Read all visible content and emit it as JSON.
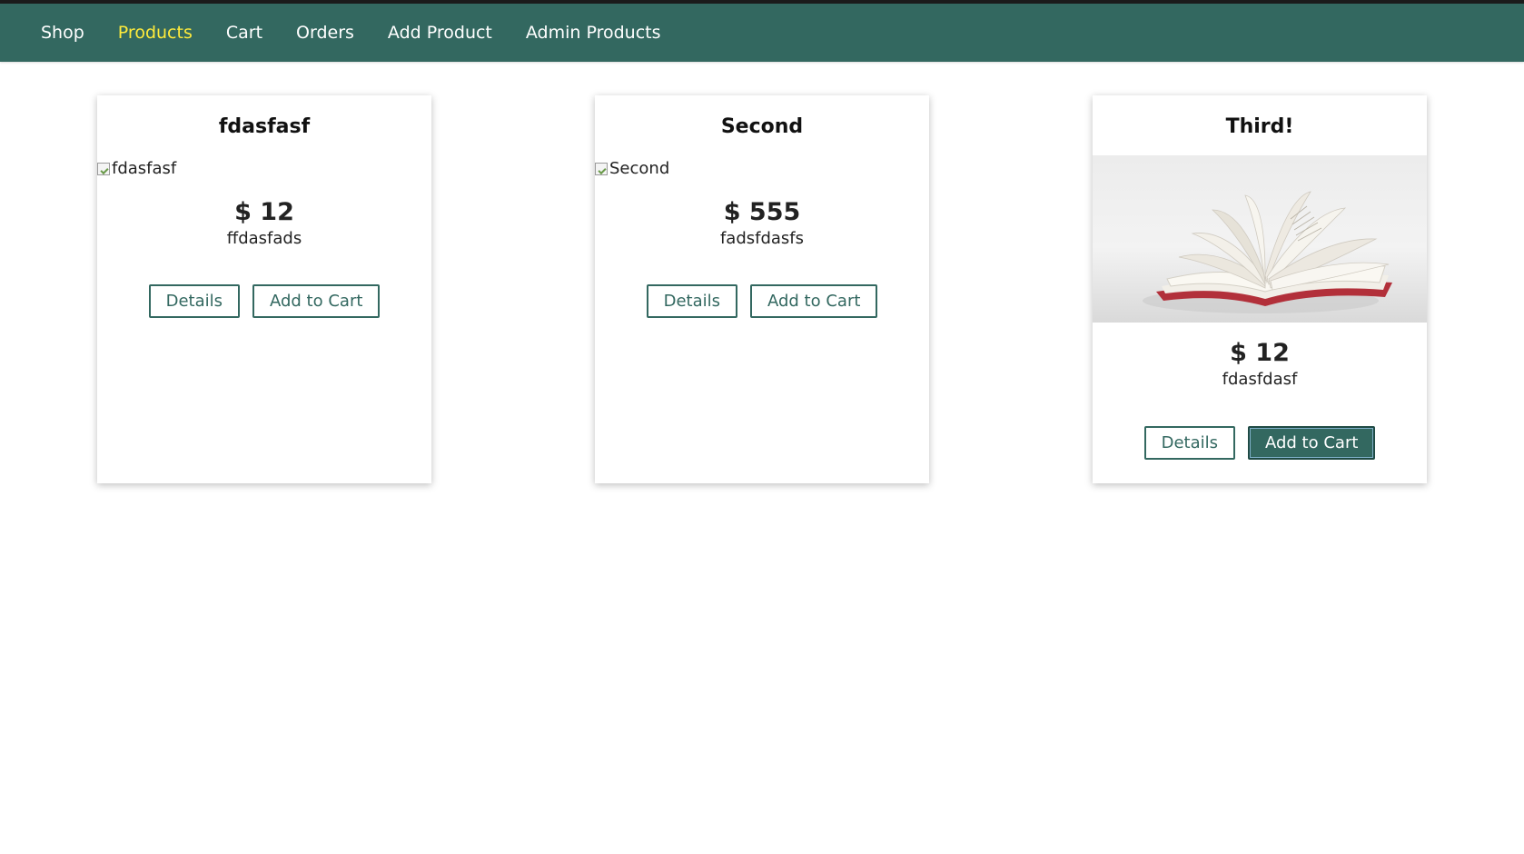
{
  "nav": {
    "items": [
      {
        "label": "Shop",
        "active": false
      },
      {
        "label": "Products",
        "active": true
      },
      {
        "label": "Cart",
        "active": false
      },
      {
        "label": "Orders",
        "active": false
      },
      {
        "label": "Add Product",
        "active": false
      },
      {
        "label": "Admin Products",
        "active": false
      }
    ]
  },
  "products": [
    {
      "title": "fdasfasf",
      "image_alt": "fdasfasf",
      "image_loaded": false,
      "price": "$ 12",
      "description": "ffdasfads",
      "details_label": "Details",
      "cart_label": "Add to Cart"
    },
    {
      "title": "Second",
      "image_alt": "Second",
      "image_loaded": false,
      "price": "$ 555",
      "description": "fadsfdasfs",
      "details_label": "Details",
      "cart_label": "Add to Cart"
    },
    {
      "title": "Third!",
      "image_alt": "book-photo",
      "image_loaded": true,
      "price": "$ 12",
      "description": "fdasfdasf",
      "details_label": "Details",
      "cart_label": "Add to Cart"
    }
  ],
  "colors": {
    "navbar_bg": "#336860",
    "nav_active": "#ffeb3b",
    "button_accent": "#336860"
  }
}
